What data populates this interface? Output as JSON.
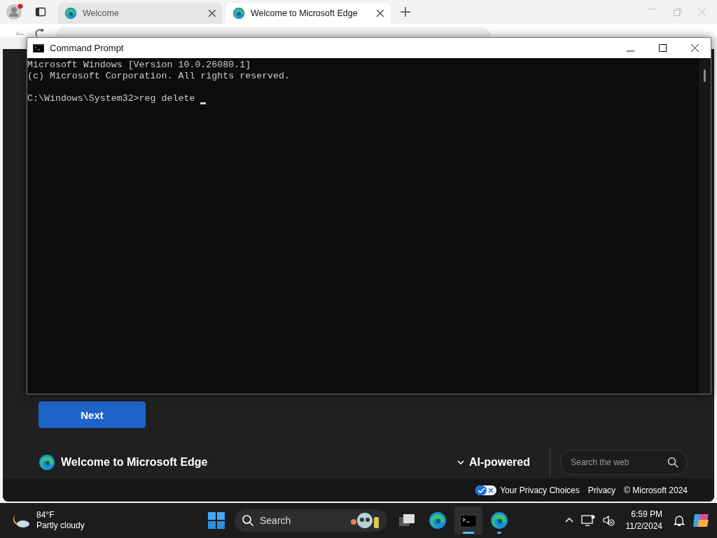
{
  "browser": {
    "tabs": [
      {
        "title": "Welcome",
        "selected": false
      },
      {
        "title": "Welcome to Microsoft Edge",
        "selected": true
      }
    ],
    "page": {
      "next_button": "Next",
      "brand": "Welcome to Microsoft Edge",
      "ai_toggle": "AI-powered",
      "search": {
        "placeholder": "Search the web"
      },
      "footer_links": [
        "Your Privacy Choices",
        "Privacy",
        "© Microsoft 2024"
      ]
    }
  },
  "console": {
    "title": "Command Prompt",
    "output": [
      "Microsoft Windows [Version 10.0.26080.1]",
      "(c) Microsoft Corporation. All rights reserved."
    ],
    "prompt": "C:\\Windows\\System32>reg delete"
  },
  "taskbar": {
    "weather": {
      "temperature": "84°F",
      "condition": "Partly cloudy"
    },
    "search": "Search",
    "apps": [
      {
        "kind": "task-view",
        "open": false,
        "focused": false
      },
      {
        "kind": "browser",
        "open": false,
        "focused": false
      },
      {
        "kind": "terminal",
        "open": true,
        "focused": true
      },
      {
        "kind": "browser",
        "open": true,
        "focused": false
      }
    ],
    "clock": {
      "time": "6:59 PM",
      "date": "11/2/2024"
    }
  }
}
